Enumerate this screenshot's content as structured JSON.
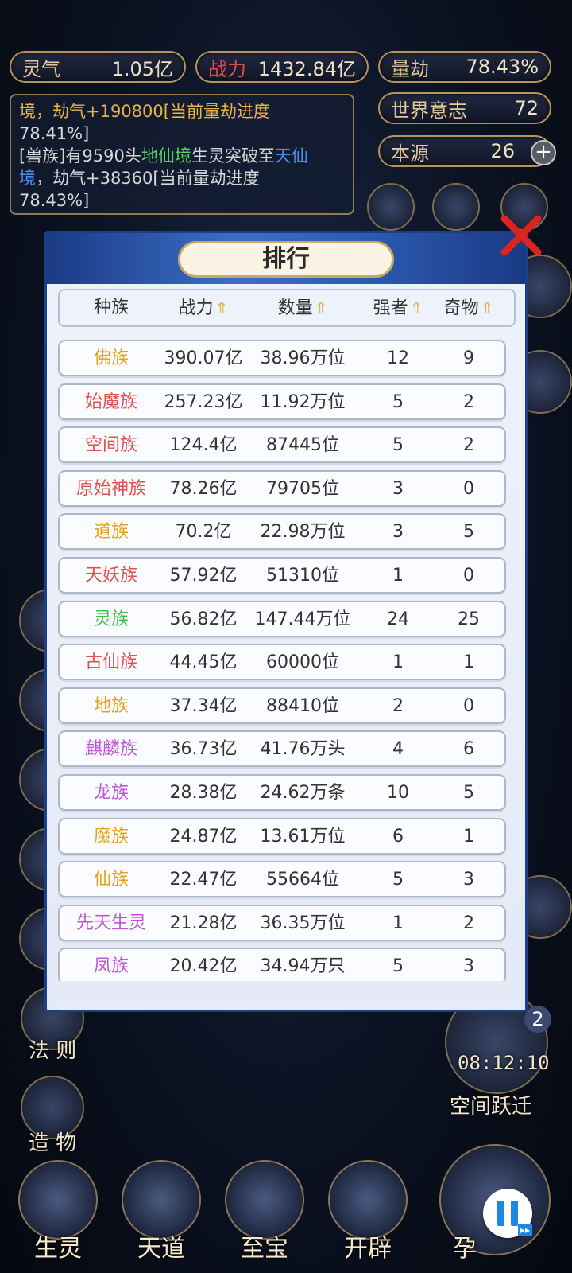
{
  "hud": {
    "lingqi_label": "灵气",
    "lingqi_value": "1.05亿",
    "zhanli_label": "战力",
    "zhanli_value": "1432.84亿",
    "liangjie_label": "量劫",
    "liangjie_value": "78.43%",
    "world_will_label": "世界意志",
    "world_will_value": "72",
    "source_label": "本源",
    "source_value": "26"
  },
  "log": {
    "line1": "境，劫气+190800[当前量劫进度",
    "line2": "78.41%]",
    "line3_a": "[兽族]有9590头",
    "line3_b": "地仙境",
    "line3_c": "生灵突破至",
    "line3_d": "天仙",
    "line4_a": "境",
    "line4_b": "，劫气+38360[当前量劫进度",
    "line5": "78.43%]"
  },
  "side": {
    "left_labels": [
      "法 则",
      "造 物"
    ],
    "right_timer": "08:12:10",
    "right_label": "空间跃迁",
    "right_badge": "2"
  },
  "bottom": {
    "buttons": [
      "生灵",
      "天道",
      "至宝",
      "开辟",
      "孕"
    ]
  },
  "modal": {
    "title": "排行",
    "headers": [
      "种族",
      "战力",
      "数量",
      "强者",
      "奇物"
    ],
    "rows": [
      {
        "name": "佛族",
        "power": "390.07亿",
        "count": "38.96万位",
        "strong": "12",
        "items": "9",
        "color": "#e5a21b"
      },
      {
        "name": "始魔族",
        "power": "257.23亿",
        "count": "11.92万位",
        "strong": "5",
        "items": "2",
        "color": "#e0504d"
      },
      {
        "name": "空间族",
        "power": "124.4亿",
        "count": "87445位",
        "strong": "5",
        "items": "2",
        "color": "#e0504d"
      },
      {
        "name": "原始神族",
        "power": "78.26亿",
        "count": "79705位",
        "strong": "3",
        "items": "0",
        "color": "#e0504d"
      },
      {
        "name": "道族",
        "power": "70.2亿",
        "count": "22.98万位",
        "strong": "3",
        "items": "5",
        "color": "#e5a21b"
      },
      {
        "name": "天妖族",
        "power": "57.92亿",
        "count": "51310位",
        "strong": "1",
        "items": "0",
        "color": "#e0504d"
      },
      {
        "name": "灵族",
        "power": "56.82亿",
        "count": "147.44万位",
        "strong": "24",
        "items": "25",
        "color": "#3fbf4a"
      },
      {
        "name": "古仙族",
        "power": "44.45亿",
        "count": "60000位",
        "strong": "1",
        "items": "1",
        "color": "#e0504d"
      },
      {
        "name": "地族",
        "power": "37.34亿",
        "count": "88410位",
        "strong": "2",
        "items": "0",
        "color": "#e5a21b"
      },
      {
        "name": "麒麟族",
        "power": "36.73亿",
        "count": "41.76万头",
        "strong": "4",
        "items": "6",
        "color": "#c154d6"
      },
      {
        "name": "龙族",
        "power": "28.38亿",
        "count": "24.62万条",
        "strong": "10",
        "items": "5",
        "color": "#c154d6"
      },
      {
        "name": "魔族",
        "power": "24.87亿",
        "count": "13.61万位",
        "strong": "6",
        "items": "1",
        "color": "#e5a21b"
      },
      {
        "name": "仙族",
        "power": "22.47亿",
        "count": "55664位",
        "strong": "5",
        "items": "3",
        "color": "#e5a21b"
      },
      {
        "name": "先天生灵",
        "power": "21.28亿",
        "count": "36.35万位",
        "strong": "1",
        "items": "2",
        "color": "#c154d6"
      },
      {
        "name": "凤族",
        "power": "20.42亿",
        "count": "34.94万只",
        "strong": "5",
        "items": "3",
        "color": "#c154d6"
      }
    ]
  }
}
